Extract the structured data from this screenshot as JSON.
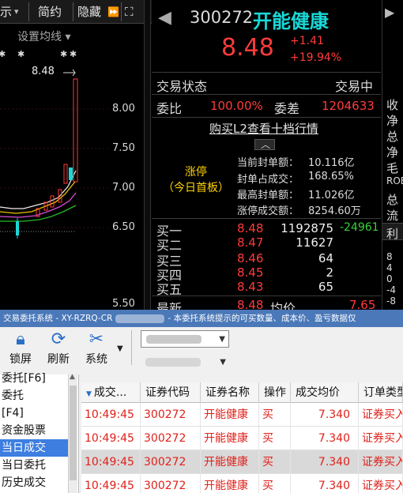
{
  "toolbar": {
    "items": [
      "示",
      "简约",
      "隐藏"
    ],
    "settings_icon": "gear-icon",
    "expand_icon": "expand-icon",
    "double_chevron_icon": "double-chevron-right-icon"
  },
  "chart": {
    "ma_setting": "设置均线",
    "price_mark": "8.48",
    "y_ticks": [
      "8.00",
      "7.50",
      "7.00",
      "6.50",
      "5.50"
    ]
  },
  "quote": {
    "code": "300272",
    "name": "开能健康",
    "price": "8.48",
    "change": "+1.41",
    "change_pct": "+19.94%",
    "status_label": "交易状态",
    "status_value": "交易中",
    "weibi_label": "委比",
    "weibi_value": "100.00%",
    "weicha_label": "委差",
    "weicha_value": "1204633",
    "l2_link": "购买L2查看十档行情",
    "limit_up_title": "涨停",
    "limit_up_sub": "（今日首板）",
    "seal": [
      {
        "label": "当前封单额：",
        "value": "10.116亿"
      },
      {
        "label": "封单占成交：",
        "value": "168.65%"
      },
      {
        "label": "最高封单额：",
        "value": "11.026亿"
      },
      {
        "label": "涨停成交额：",
        "value": "8254.60万"
      }
    ],
    "bids": [
      {
        "label": "买一",
        "price": "8.48",
        "vol": "1192875",
        "chg": "-24961"
      },
      {
        "label": "买二",
        "price": "8.47",
        "vol": "11627",
        "chg": ""
      },
      {
        "label": "买三",
        "price": "8.46",
        "vol": "64",
        "chg": ""
      },
      {
        "label": "买四",
        "price": "8.45",
        "vol": "2",
        "chg": ""
      },
      {
        "label": "买五",
        "price": "8.43",
        "vol": "65",
        "chg": ""
      }
    ],
    "last_label": "最新",
    "last_price": "8.48",
    "avg_label": "均价",
    "avg_price": "7.65"
  },
  "side": {
    "items": [
      "收",
      "净",
      "总",
      "净",
      "毛",
      "ROE",
      "总",
      "流"
    ],
    "tab": "利",
    "nums": [
      "8",
      "4",
      "0",
      "-4",
      "-8"
    ]
  },
  "trade": {
    "title_left": "交易委托系统 - XY-RZRQ-CR",
    "title_right": "- 本委托系统提示的可买数量、成本价、盈亏数据仅",
    "tools": [
      {
        "label": "锁屏",
        "icon": "lock-icon"
      },
      {
        "label": "刷新",
        "icon": "refresh-icon"
      },
      {
        "label": "系统",
        "icon": "tools-icon"
      }
    ],
    "nav": [
      "委托[F6]",
      "委托",
      "[F4]",
      "资金股票",
      "当日成交",
      "当日委托",
      "历史成交"
    ],
    "nav_selected": 4,
    "headers": [
      "成交...",
      "证券代码",
      "证券名称",
      "操作",
      "成交均价",
      "订单类型"
    ],
    "rows": [
      [
        "10:49:45",
        "300272",
        "开能健康",
        "买",
        "7.340",
        "证券买入"
      ],
      [
        "10:49:45",
        "300272",
        "开能健康",
        "买",
        "7.340",
        "证券买入"
      ],
      [
        "10:49:45",
        "300272",
        "开能健康",
        "买",
        "7.340",
        "证券买入"
      ],
      [
        "10:49:45",
        "300272",
        "开能健康",
        "买",
        "7.340",
        "证券买入"
      ]
    ]
  },
  "colors": {
    "up": "#ff3b3b",
    "down": "#3ad13a",
    "cyan": "#19d8d8",
    "accent": "#3d7ee0"
  }
}
